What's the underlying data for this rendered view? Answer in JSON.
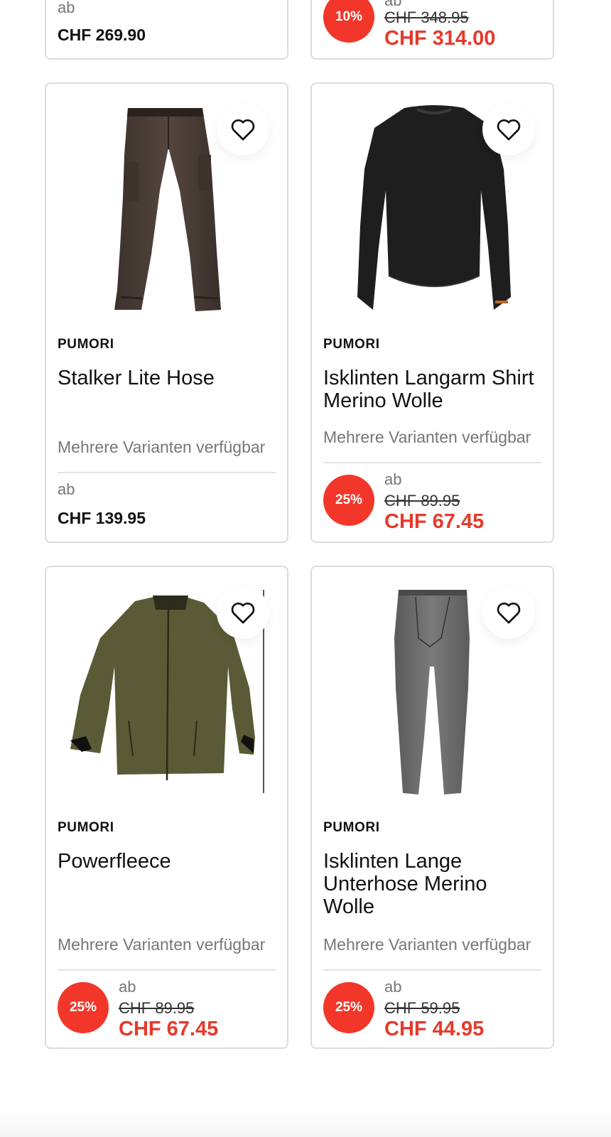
{
  "colors": {
    "accent": "#e53a2c",
    "badge": "#f2372a",
    "border": "#dcdcdc"
  },
  "top_row": [
    {
      "ab": "ab",
      "price": "CHF 269.90"
    },
    {
      "ab": "ab",
      "badge": "10%",
      "old_price": "CHF 348.95",
      "new_price": "CHF 314.00"
    }
  ],
  "products": [
    {
      "brand": "PUMORI",
      "title": "Stalker Lite Hose",
      "variants": "Mehrere Varianten verfügbar",
      "ab": "ab",
      "price": "CHF 139.95",
      "image": "brown-pants",
      "wish_icon": "heart-icon"
    },
    {
      "brand": "PUMORI",
      "title": "Isklinten Langarm Shirt Merino Wolle",
      "variants": "Mehrere Varianten verfügbar",
      "ab": "ab",
      "badge": "25%",
      "old_price": "CHF 89.95",
      "new_price": "CHF 67.45",
      "image": "black-long-sleeve-shirt",
      "wish_icon": "heart-icon"
    },
    {
      "brand": "PUMORI",
      "title": "Powerfleece",
      "variants": "Mehrere Varianten verfügbar",
      "ab": "ab",
      "badge": "25%",
      "old_price": "CHF 89.95",
      "new_price": "CHF 67.45",
      "image": "olive-fleece-jacket",
      "wish_icon": "heart-icon"
    },
    {
      "brand": "PUMORI",
      "title": "Isklinten Lange Unterhose Merino Wolle",
      "variants": "Mehrere Varianten verfügbar",
      "ab": "ab",
      "badge": "25%",
      "old_price": "CHF 59.95",
      "new_price": "CHF 44.95",
      "image": "grey-long-underpants",
      "wish_icon": "heart-icon"
    }
  ]
}
